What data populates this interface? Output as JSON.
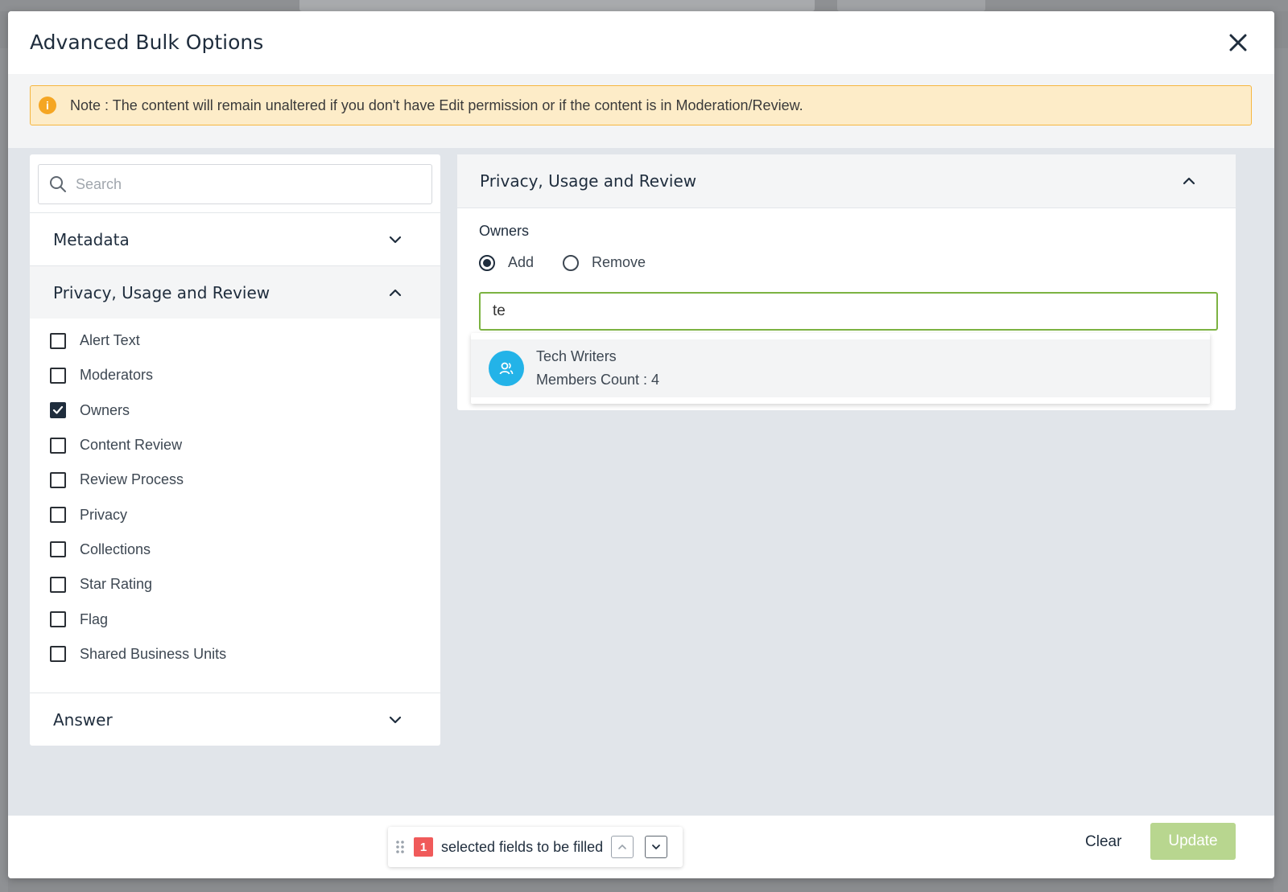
{
  "modal": {
    "title": "Advanced Bulk Options",
    "note": "Note : The content will remain unaltered if you don't have Edit permission or if the content is in Moderation/Review."
  },
  "left_panel": {
    "search_placeholder": "Search",
    "sections": [
      {
        "label": "Metadata",
        "expanded": false
      },
      {
        "label": "Privacy, Usage and Review",
        "expanded": true
      },
      {
        "label": "Answer",
        "expanded": false
      }
    ],
    "fields": [
      {
        "label": "Alert Text",
        "checked": false
      },
      {
        "label": "Moderators",
        "checked": false
      },
      {
        "label": "Owners",
        "checked": true
      },
      {
        "label": "Content Review",
        "checked": false
      },
      {
        "label": "Review Process",
        "checked": false
      },
      {
        "label": "Privacy",
        "checked": false
      },
      {
        "label": "Collections",
        "checked": false
      },
      {
        "label": "Star Rating",
        "checked": false
      },
      {
        "label": "Flag",
        "checked": false
      },
      {
        "label": "Shared Business Units",
        "checked": false
      }
    ]
  },
  "right_panel": {
    "title": "Privacy, Usage and Review",
    "owners_label": "Owners",
    "radio_add": "Add",
    "radio_remove": "Remove",
    "selected_mode": "Add",
    "owner_input_value": "te",
    "suggestion": {
      "name": "Tech Writers",
      "members": "Members Count : 4"
    }
  },
  "footer": {
    "selected_count": "1",
    "fields_text": "selected fields to be filled",
    "clear_label": "Clear",
    "update_label": "Update"
  },
  "colors": {
    "accent_green": "#7cb342",
    "update_disabled": "#b8d68f",
    "badge_red": "#f05a5a",
    "avatar_blue": "#23b3e8",
    "note_bg": "#fdecc8"
  }
}
